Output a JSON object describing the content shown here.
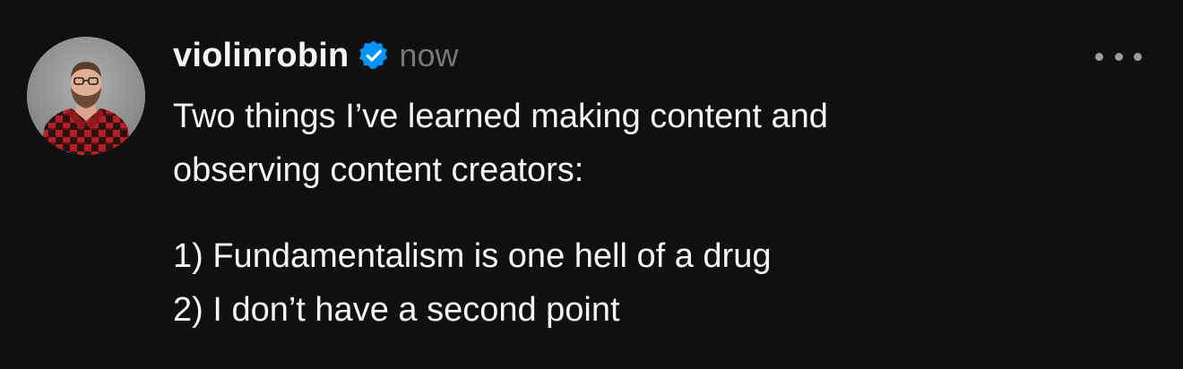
{
  "post": {
    "username": "violinrobin",
    "timestamp": "now",
    "verified_icon": "verified-badge-icon",
    "more_icon": "ellipsis-icon",
    "paragraphs": [
      {
        "lines": [
          "Two things I’ve learned making content and",
          "observing content creators:"
        ]
      },
      {
        "lines": [
          "1) Fundamentalism is one hell of a drug",
          "2) I don’t have a second point"
        ]
      }
    ]
  },
  "colors": {
    "background": "#101010",
    "text_primary": "#f3f5f7",
    "text_secondary": "#777777",
    "verified_blue": "#0095f6"
  }
}
